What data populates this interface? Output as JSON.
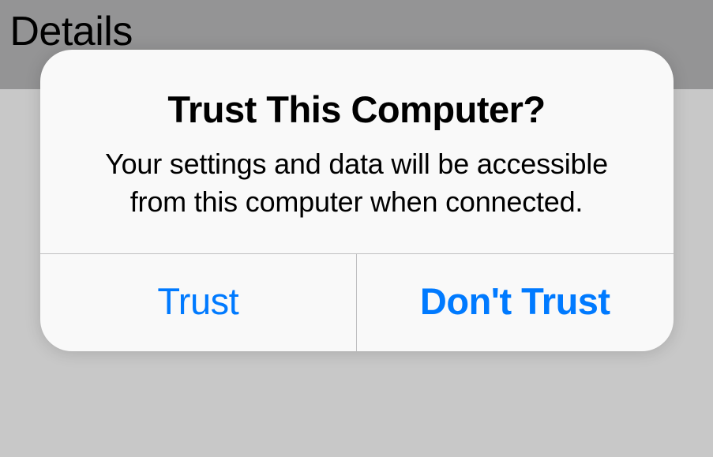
{
  "background": {
    "partial_text": "e Details"
  },
  "dialog": {
    "title": "Trust This Computer?",
    "message": "Your settings and data will be accessible from this computer when connected.",
    "buttons": {
      "trust": "Trust",
      "dont_trust": "Don't Trust"
    }
  },
  "colors": {
    "backdrop_top": "#949495",
    "backdrop_bottom": "#c8c8c8",
    "modal_bg": "#f9f9f9",
    "button_text": "#007aff",
    "divider": "#bfbfc1"
  }
}
